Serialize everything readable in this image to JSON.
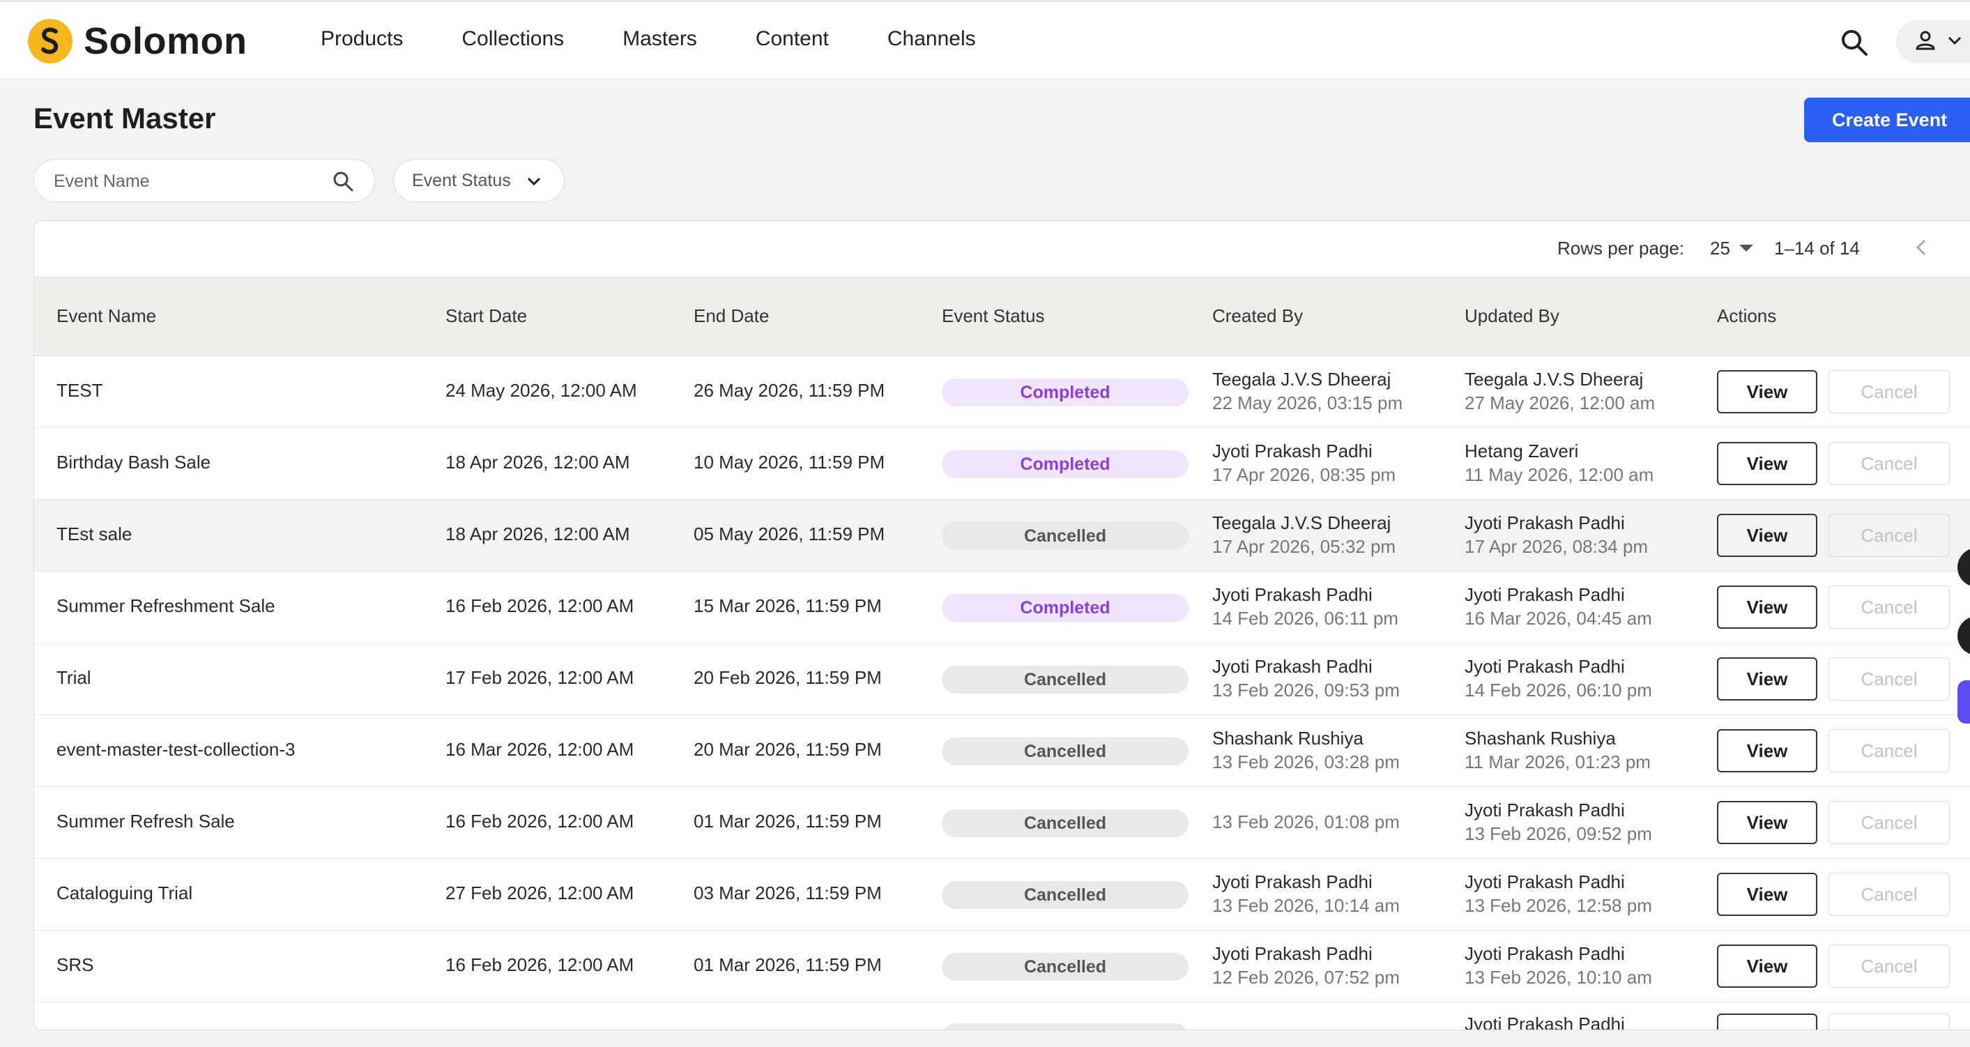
{
  "header": {
    "brand": "Solomon",
    "nav": [
      "Products",
      "Collections",
      "Masters",
      "Content",
      "Channels"
    ]
  },
  "page": {
    "title": "Event Master",
    "create_label": "Create Event"
  },
  "filters": {
    "search_placeholder": "Event Name",
    "status_label": "Event Status"
  },
  "pagination": {
    "rows_label": "Rows per page:",
    "rows_value": "25",
    "range": "1–14 of 14"
  },
  "table": {
    "columns": [
      "Event Name",
      "Start Date",
      "End Date",
      "Event Status",
      "Created By",
      "Updated By",
      "Actions"
    ],
    "view_label": "View",
    "cancel_label": "Cancel",
    "rows": [
      {
        "name": "TEST",
        "start": "24 May 2026, 12:00 AM",
        "end": "26 May 2026, 11:59 PM",
        "status": "Completed",
        "created_by": "Teegala J.V.S Dheeraj",
        "created_at": "22 May 2026, 03:15 pm",
        "updated_by": "Teegala J.V.S Dheeraj",
        "updated_at": "27 May 2026, 12:00 am"
      },
      {
        "name": "Birthday Bash Sale",
        "start": "18 Apr 2026, 12:00 AM",
        "end": "10 May 2026, 11:59 PM",
        "status": "Completed",
        "created_by": "Jyoti Prakash Padhi",
        "created_at": "17 Apr 2026, 08:35 pm",
        "updated_by": "Hetang Zaveri",
        "updated_at": "11 May 2026, 12:00 am"
      },
      {
        "name": "TEst sale",
        "start": "18 Apr 2026, 12:00 AM",
        "end": "05 May 2026, 11:59 PM",
        "status": "Cancelled",
        "created_by": "Teegala J.V.S Dheeraj",
        "created_at": "17 Apr 2026, 05:32 pm",
        "updated_by": "Jyoti Prakash Padhi",
        "updated_at": "17 Apr 2026, 08:34 pm"
      },
      {
        "name": "Summer Refreshment Sale",
        "start": "16 Feb 2026, 12:00 AM",
        "end": "15 Mar 2026, 11:59 PM",
        "status": "Completed",
        "created_by": "Jyoti Prakash Padhi",
        "created_at": "14 Feb 2026, 06:11 pm",
        "updated_by": "Jyoti Prakash Padhi",
        "updated_at": "16 Mar 2026, 04:45 am"
      },
      {
        "name": "Trial",
        "start": "17 Feb 2026, 12:00 AM",
        "end": "20 Feb 2026, 11:59 PM",
        "status": "Cancelled",
        "created_by": "Jyoti Prakash Padhi",
        "created_at": "13 Feb 2026, 09:53 pm",
        "updated_by": "Jyoti Prakash Padhi",
        "updated_at": "14 Feb 2026, 06:10 pm"
      },
      {
        "name": "event-master-test-collection-3",
        "start": "16 Mar 2026, 12:00 AM",
        "end": "20 Mar 2026, 11:59 PM",
        "status": "Cancelled",
        "created_by": "Shashank Rushiya",
        "created_at": "13 Feb 2026, 03:28 pm",
        "updated_by": "Shashank Rushiya",
        "updated_at": "11 Mar 2026, 01:23 pm"
      },
      {
        "name": "Summer Refresh Sale",
        "start": "16 Feb 2026, 12:00 AM",
        "end": "01 Mar 2026, 11:59 PM",
        "status": "Cancelled",
        "created_by": "",
        "created_at": "13 Feb 2026, 01:08 pm",
        "updated_by": "Jyoti Prakash Padhi",
        "updated_at": "13 Feb 2026, 09:52 pm"
      },
      {
        "name": "Cataloguing Trial",
        "start": "27 Feb 2026, 12:00 AM",
        "end": "03 Mar 2026, 11:59 PM",
        "status": "Cancelled",
        "created_by": "Jyoti Prakash Padhi",
        "created_at": "13 Feb 2026, 10:14 am",
        "updated_by": "Jyoti Prakash Padhi",
        "updated_at": "13 Feb 2026, 12:58 pm"
      },
      {
        "name": "SRS",
        "start": "16 Feb 2026, 12:00 AM",
        "end": "01 Mar 2026, 11:59 PM",
        "status": "Cancelled",
        "created_by": "Jyoti Prakash Padhi",
        "created_at": "12 Feb 2026, 07:52 pm",
        "updated_by": "Jyoti Prakash Padhi",
        "updated_at": "13 Feb 2026, 10:10 am"
      },
      {
        "name": "",
        "start": "",
        "end": "",
        "status": "Cancelled",
        "created_by": "",
        "created_at": "",
        "updated_by": "Jyoti Prakash Padhi",
        "updated_at": ""
      }
    ]
  },
  "colors": {
    "accent": "#2a5ff5",
    "brand": "#f6b71e",
    "completed_bg": "#f1e4fd",
    "completed_text": "#8a3ee0",
    "cancelled_bg": "#e9e9e9"
  },
  "icons": [
    "search-icon",
    "user-icon",
    "chevron-down-icon",
    "chevron-left-icon",
    "chevron-right-icon"
  ]
}
